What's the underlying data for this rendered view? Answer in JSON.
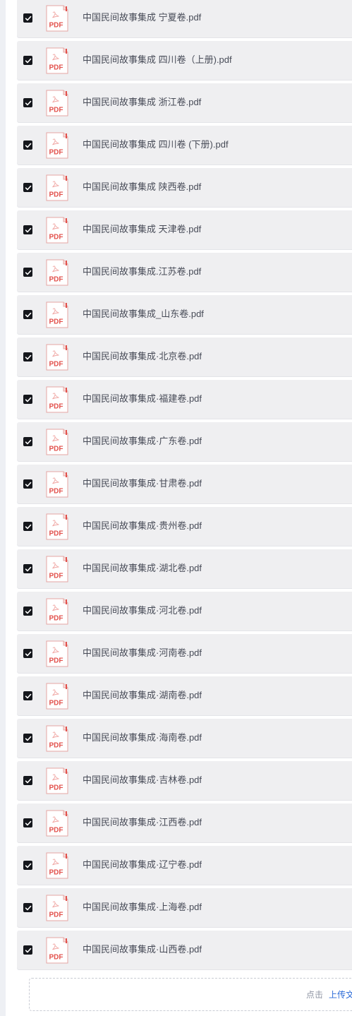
{
  "files": [
    {
      "name": "中国民间故事集成  宁夏卷.pdf",
      "checked": true
    },
    {
      "name": "中国民间故事集成  四川卷（上册).pdf",
      "checked": true
    },
    {
      "name": "中国民间故事集成  浙江卷.pdf",
      "checked": true
    },
    {
      "name": "中国民间故事集成 四川卷 (下册).pdf",
      "checked": true
    },
    {
      "name": "中国民间故事集成 陕西卷.pdf",
      "checked": true
    },
    {
      "name": "中国民间故事集成 天津卷.pdf",
      "checked": true
    },
    {
      "name": "中国民间故事集成.江苏卷.pdf",
      "checked": true
    },
    {
      "name": "中国民间故事集成_山东卷.pdf",
      "checked": true
    },
    {
      "name": "中国民间故事集成·北京卷.pdf",
      "checked": true
    },
    {
      "name": "中国民间故事集成·福建卷.pdf",
      "checked": true
    },
    {
      "name": "中国民间故事集成·广东卷.pdf",
      "checked": true
    },
    {
      "name": "中国民间故事集成·甘肃卷.pdf",
      "checked": true
    },
    {
      "name": "中国民间故事集成·贵州卷.pdf",
      "checked": true
    },
    {
      "name": "中国民间故事集成·湖北卷.pdf",
      "checked": true
    },
    {
      "name": "中国民间故事集成·河北卷.pdf",
      "checked": true
    },
    {
      "name": "中国民间故事集成·河南卷.pdf",
      "checked": true
    },
    {
      "name": "中国民间故事集成·湖南卷.pdf",
      "checked": true
    },
    {
      "name": "中国民间故事集成·海南卷.pdf",
      "checked": true
    },
    {
      "name": "中国民间故事集成·吉林卷.pdf",
      "checked": true
    },
    {
      "name": "中国民间故事集成·江西卷.pdf",
      "checked": true
    },
    {
      "name": "中国民间故事集成·辽宁卷.pdf",
      "checked": true
    },
    {
      "name": "中国民间故事集成·上海卷.pdf",
      "checked": true
    },
    {
      "name": "中国民间故事集成·山西卷.pdf",
      "checked": true
    }
  ],
  "file_icon": {
    "name": "pdf-file-icon",
    "label": "PDF",
    "accent": "#e2514c"
  },
  "checkbox_icon": "checkmark-icon",
  "upload": {
    "hint": "点击",
    "link": "上传文件"
  },
  "colors": {
    "row_background": "#efeff1",
    "checkbox": "#15171c",
    "link": "#2a6ad8",
    "text": "#474b57"
  }
}
